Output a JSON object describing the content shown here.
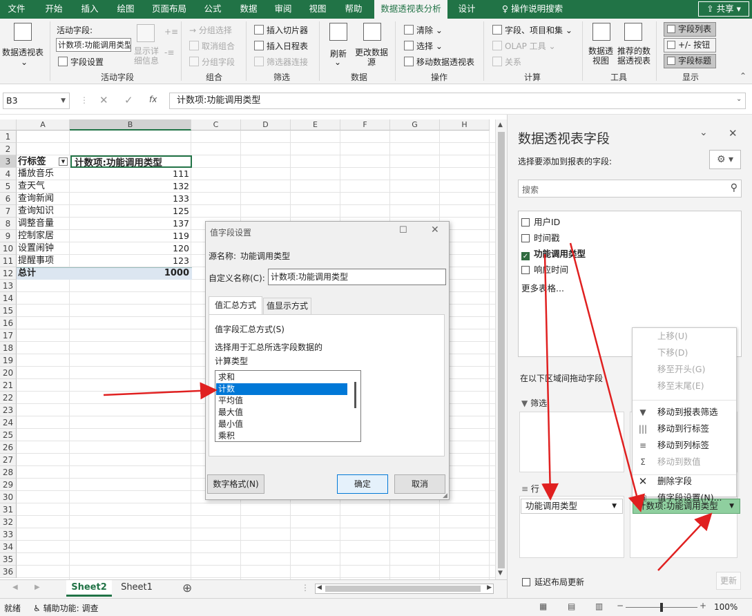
{
  "tabs": [
    "文件",
    "开始",
    "插入",
    "绘图",
    "页面布局",
    "公式",
    "数据",
    "审阅",
    "视图",
    "帮助",
    "数据透视表分析",
    "设计",
    "操作说明搜索"
  ],
  "share_label": "共享",
  "ribbon": {
    "pivot_table": "数据透视表",
    "active_field_label": "活动字段:",
    "active_field_value": "计数项:功能调用类型",
    "field_settings": "字段设置",
    "drill_down": "显示详细信息",
    "group_active_field": "活动字段",
    "group_selection": "分组选择",
    "ungroup": "取消组合",
    "group_field": "分组字段",
    "group_group": "组合",
    "insert_slicer": "插入切片器",
    "insert_timeline": "插入日程表",
    "filter_connections": "筛选器连接",
    "group_filter": "筛选",
    "refresh": "刷新",
    "change_source": "更改数据源",
    "group_data": "数据",
    "clear": "清除",
    "select": "选择",
    "move_pivot": "移动数据透视表",
    "group_actions": "操作",
    "fields_items_sets": "字段、项目和集",
    "olap_tools": "OLAP 工具",
    "relationships": "关系",
    "group_calc": "计算",
    "pivot_chart": "数据透视图",
    "recommended": "推荐的数据透视表",
    "group_tools": "工具",
    "field_list": "字段列表",
    "buttons": "+/- 按钮",
    "field_headers": "字段标题",
    "group_show": "显示"
  },
  "formula_bar": {
    "name_box": "B3",
    "formula": "计数项:功能调用类型",
    "fx": "fx"
  },
  "columns": [
    "A",
    "B",
    "C",
    "D",
    "E",
    "F",
    "G",
    "H"
  ],
  "rows": [
    "1",
    "2",
    "3",
    "4",
    "5",
    "6",
    "7",
    "8",
    "9",
    "10",
    "11",
    "12",
    "13",
    "14",
    "15",
    "16",
    "17",
    "18",
    "19",
    "20",
    "21",
    "22",
    "23",
    "24",
    "25",
    "26",
    "27",
    "28",
    "29",
    "30",
    "31",
    "32",
    "33",
    "34",
    "35",
    "36"
  ],
  "pivot": {
    "header_label": "行标签",
    "header_value": "计数项:功能调用类型",
    "items": [
      {
        "label": "播放音乐",
        "value": "111"
      },
      {
        "label": "查天气",
        "value": "132"
      },
      {
        "label": "查询新闻",
        "value": "133"
      },
      {
        "label": "查询知识",
        "value": "125"
      },
      {
        "label": "调整音量",
        "value": "137"
      },
      {
        "label": "控制家居",
        "value": "119"
      },
      {
        "label": "设置闹钟",
        "value": "120"
      },
      {
        "label": "提醒事项",
        "value": "123"
      }
    ],
    "total_label": "总计",
    "total_value": "1000"
  },
  "sheets": [
    "Sheet2",
    "Sheet1"
  ],
  "status": {
    "ready": "就绪",
    "accessibility": "辅助功能: 调查",
    "zoom": "100%"
  },
  "dialog": {
    "title": "值字段设置",
    "source_label": "源名称:",
    "source_value": "功能调用类型",
    "custom_label": "自定义名称(C):",
    "custom_value": "计数项:功能调用类型",
    "tab_summarize": "值汇总方式",
    "tab_show": "值显示方式",
    "section": "值字段汇总方式(S)",
    "desc": "选择用于汇总所选字段数据的",
    "calc_type": "计算类型",
    "options": [
      "求和",
      "计数",
      "平均值",
      "最大值",
      "最小值",
      "乘积"
    ],
    "selected": "计数",
    "number_format": "数字格式(N)",
    "ok": "确定",
    "cancel": "取消"
  },
  "panel": {
    "title": "数据透视表字段",
    "choose": "选择要添加到报表的字段:",
    "search_placeholder": "搜索",
    "fields": [
      {
        "name": "用户ID",
        "checked": false
      },
      {
        "name": "时间戳",
        "checked": false
      },
      {
        "name": "功能调用类型",
        "checked": true
      },
      {
        "name": "响应时间",
        "checked": false
      }
    ],
    "more_tables": "更多表格...",
    "drag_label": "在以下区域间拖动字段",
    "filter_label": "筛选",
    "row_label": "行",
    "row_field": "功能调用类型",
    "value_field": "计数项:功能调用类型",
    "defer": "延迟布局更新",
    "update": "更新"
  },
  "context_menu": [
    {
      "label": "上移(U)",
      "disabled": true,
      "icon": ""
    },
    {
      "label": "下移(D)",
      "disabled": true,
      "icon": ""
    },
    {
      "label": "移至开头(G)",
      "disabled": true,
      "icon": ""
    },
    {
      "label": "移至末尾(E)",
      "disabled": true,
      "icon": ""
    },
    {
      "label": "移动到报表筛选",
      "disabled": false,
      "icon": "filter-icon"
    },
    {
      "label": "移动到行标签",
      "disabled": false,
      "icon": "rows-icon"
    },
    {
      "label": "移动到列标签",
      "disabled": false,
      "icon": "columns-icon"
    },
    {
      "label": "移动到数值",
      "disabled": true,
      "icon": "sigma-icon"
    },
    {
      "label": "删除字段",
      "disabled": false,
      "icon": "x-icon"
    },
    {
      "label": "值字段设置(N)...",
      "disabled": false,
      "icon": "settings-icon"
    }
  ],
  "colors": {
    "brand": "#217346",
    "selected": "#0078d7",
    "arrow": "#e02020"
  }
}
